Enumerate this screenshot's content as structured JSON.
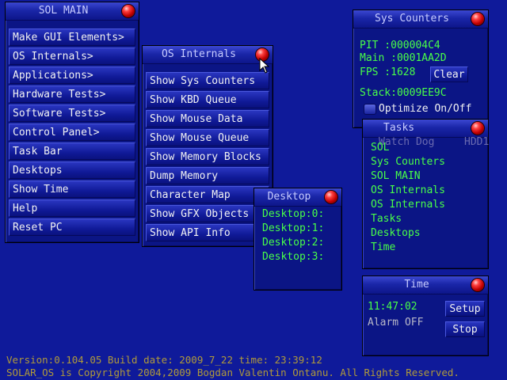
{
  "sol_main": {
    "title": "SOL MAIN",
    "items": [
      "Make GUI Elements>",
      "OS Internals>",
      "Applications>",
      "Hardware Tests>",
      "Software Tests>",
      "Control Panel>",
      "Task Bar",
      "Desktops",
      "Show Time",
      "Help",
      "Reset PC"
    ]
  },
  "os_internals": {
    "title": "OS Internals",
    "items": [
      "Show Sys Counters",
      "Show KBD Queue",
      "Show Mouse Data",
      "Show Mouse Queue",
      "Show Memory Blocks",
      "Dump Memory",
      "Character Map",
      "Show GFX Objects",
      "Show API Info"
    ]
  },
  "desktop": {
    "title": "Desktop",
    "items": [
      "Desktop:0:",
      "Desktop:1:",
      "Desktop:2:",
      "Desktop:3:"
    ]
  },
  "sys_counters": {
    "title": "Sys Counters",
    "pit": "PIT  :000004C4",
    "main": "Main :0001AA2D",
    "fps": "FPS  :1628",
    "clear_label": "Clear",
    "stack": "Stack:0009EE9C",
    "optimize_label": "Optimize On/Off",
    "watchdog_label": "Watch Dog",
    "hdd_label": "HDD1"
  },
  "tasks": {
    "title": "Tasks",
    "items": [
      "SOL",
      "Sys Counters",
      "SOL MAIN",
      "OS Internals",
      "OS Internals",
      "Tasks",
      "Desktops",
      "Time"
    ]
  },
  "time_win": {
    "title": "Time",
    "clock": "11:47:02",
    "alarm": "Alarm OFF",
    "setup_label": "Setup",
    "stop_label": "Stop"
  },
  "footer": {
    "version_line": "Version:0.104.05  Build date: 2009_7_22  time: 23:39:12",
    "copyright_line": "SOLAR_OS is Copyright 2004,2009 Bogdan Valentin Ontanu. All Rights Reserved."
  },
  "colors": {
    "desktop_bg": "#0f1a9a",
    "green_text": "#48ff48",
    "footer_text": "#b09a3a",
    "close_ball": "#c00000"
  }
}
